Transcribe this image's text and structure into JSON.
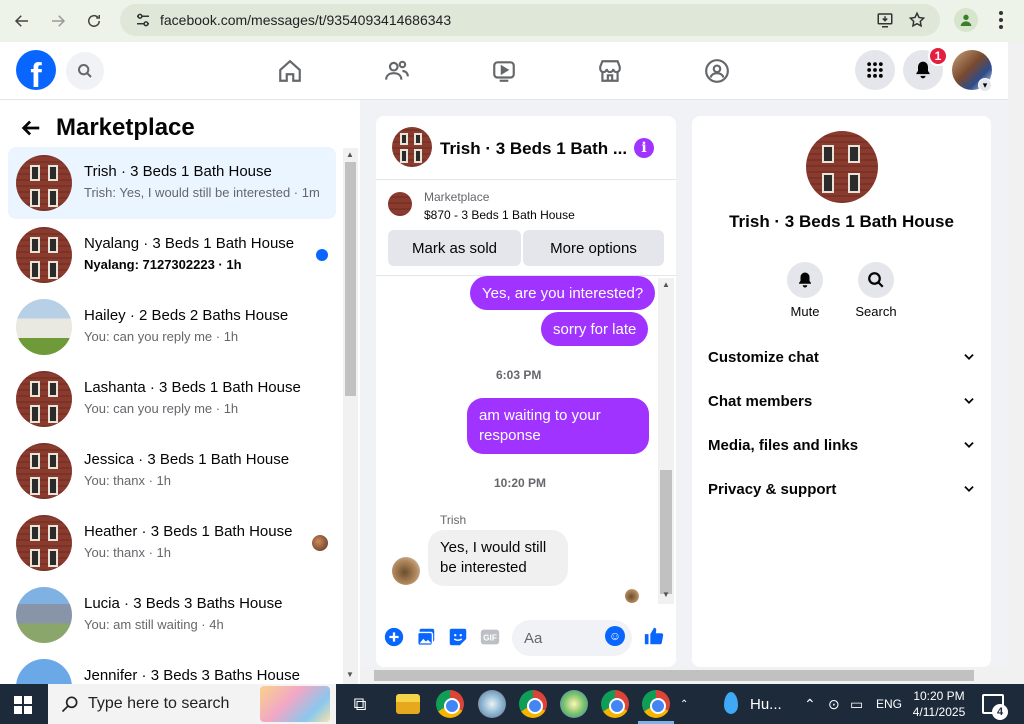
{
  "browser": {
    "url": "facebook.com/messages/t/9354093414686343"
  },
  "header": {
    "logo_letter": "f",
    "notification_count": "1",
    "nav_icons": [
      "home-icon",
      "friends-icon",
      "video-icon",
      "marketplace-icon",
      "groups-icon"
    ]
  },
  "left_panel": {
    "title": "Marketplace",
    "conversations": [
      {
        "name": "Trish · 3 Beds 1 Bath House",
        "snippet": "Trish: Yes, I would still be interested · 1m",
        "active": true
      },
      {
        "name": "Nyalang · 3 Beds 1 Bath House",
        "snippet": "Nyalang: 7127302223 · 1h",
        "unread": true
      },
      {
        "name": "Hailey · 2 Beds 2 Baths House",
        "snippet": "You: can you reply me · 1h"
      },
      {
        "name": "Lashanta · 3 Beds 1 Bath House",
        "snippet": "You: can you reply me · 1h"
      },
      {
        "name": "Jessica · 3 Beds 1 Bath House",
        "snippet": "You: thanx · 1h"
      },
      {
        "name": "Heather · 3 Beds 1 Bath House",
        "snippet": "You: thanx · 1h"
      },
      {
        "name": "Lucia · 3 Beds 3 Baths House",
        "snippet": "You: am still waiting · 4h"
      },
      {
        "name": "Jennifer · 3 Beds 3 Baths House",
        "snippet": ""
      }
    ]
  },
  "chat": {
    "title": "Trish · 3 Beds 1 Bath ...",
    "listing_source": "Marketplace",
    "listing_price": "$870 - 3 Beds 1 Bath House",
    "mark_sold": "Mark as sold",
    "more_options": "More options",
    "messages": {
      "out1": "Yes, are you interested?",
      "out2": "sorry for late",
      "time1": "6:03 PM",
      "out3": "am waiting to your response",
      "time2": "10:20 PM",
      "sender": "Trish",
      "in1": "Yes, I would still be interested"
    },
    "composer_placeholder": "Aa"
  },
  "right_panel": {
    "name": "Trish · 3 Beds 1 Bath House",
    "mute": "Mute",
    "search": "Search",
    "sections": [
      "Customize chat",
      "Chat members",
      "Media, files and links",
      "Privacy & support"
    ]
  },
  "taskbar": {
    "search_placeholder": "Type here to search",
    "weather": "Hu...",
    "lang": "ENG",
    "time": "10:20 PM",
    "date": "4/11/2025",
    "notification_count": "4"
  }
}
